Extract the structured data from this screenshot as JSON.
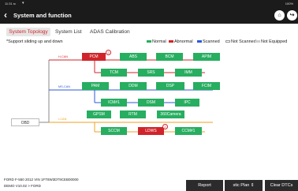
{
  "status_bar": {
    "time": "11:31 ᴍ",
    "wifi_icon": "wifi-icon",
    "battery": "100%"
  },
  "header": {
    "title": "System and function",
    "home_icon": "home-icon",
    "exit_icon": "exit-icon"
  },
  "tabs": [
    {
      "label": "System Topology",
      "active": true
    },
    {
      "label": "System List",
      "active": false
    },
    {
      "label": "ADAS Calibration",
      "active": false
    }
  ],
  "hint": "*Support sliding up and down",
  "legend": [
    {
      "label": "Normal",
      "color": "#27ae60"
    },
    {
      "label": "Abnormal",
      "color": "#d0242a"
    },
    {
      "label": "Scanned",
      "color": "#2b59d9"
    },
    {
      "label": "Not Scanned",
      "color": "#ffffff"
    },
    {
      "label": "Not Equipped",
      "color": "#cccccc"
    }
  ],
  "buses": [
    {
      "label": "H-CAN",
      "color": "#d0242a"
    },
    {
      "label": "MS-CAN",
      "color": "#2b59d9"
    },
    {
      "label": "I-CAN",
      "color": "#f0a020"
    }
  ],
  "obd": "OBD",
  "modules": [
    {
      "label": "PCM",
      "status": "abnormal",
      "badge": "2"
    },
    {
      "label": "ABS",
      "status": "normal"
    },
    {
      "label": "BCM",
      "status": "normal"
    },
    {
      "label": "APIM",
      "status": "normal"
    },
    {
      "label": "TCM",
      "status": "normal"
    },
    {
      "label": "SRS",
      "status": "normal"
    },
    {
      "label": "IMM",
      "status": "normal"
    },
    {
      "label": "PAM",
      "status": "normal"
    },
    {
      "label": "DDM",
      "status": "normal"
    },
    {
      "label": "DSP",
      "status": "normal"
    },
    {
      "label": "FCIM",
      "status": "normal"
    },
    {
      "label": "ICM#1",
      "status": "normal"
    },
    {
      "label": "DSM",
      "status": "normal"
    },
    {
      "label": "IPC",
      "status": "normal"
    },
    {
      "label": "GPSM",
      "status": "normal"
    },
    {
      "label": "RTM",
      "status": "normal"
    },
    {
      "label": "360Camera",
      "status": "normal"
    },
    {
      "label": "SCCM",
      "status": "normal"
    },
    {
      "label": "LDWS",
      "status": "abnormal",
      "badge": "2"
    },
    {
      "label": "CCM#1",
      "status": "normal"
    }
  ],
  "footer": {
    "vehicle": "FORD  F-550  2012  VIN  1FT8W3DT9CEB00000",
    "version": "DEMO V10.02 > FORD",
    "buttons": [
      "Report",
      "stic Plan  ⇕",
      "Clear DTCs"
    ]
  }
}
